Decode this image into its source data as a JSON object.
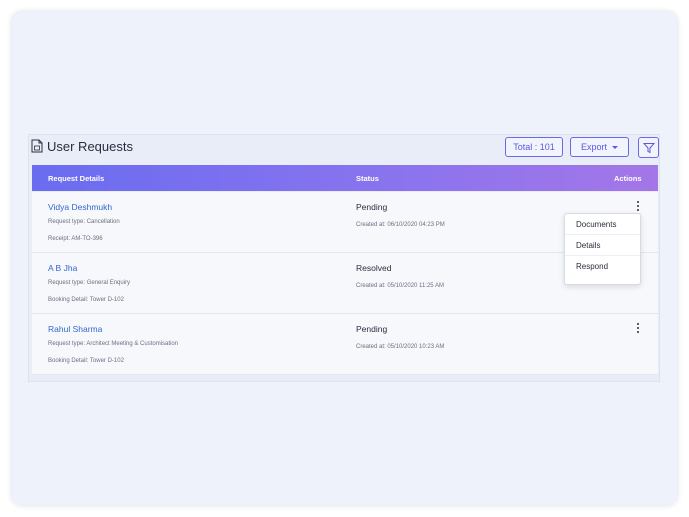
{
  "header": {
    "title": "User Requests",
    "total_label": "Total : 101",
    "export_label": "Export"
  },
  "table": {
    "columns": {
      "details": "Request Details",
      "status": "Status",
      "actions": "Actions"
    },
    "rows": [
      {
        "name": "Vidya Deshmukh",
        "line1": "Request type: Cancellation",
        "line2": "Receipt: AM-TO-396",
        "status": "Pending",
        "created": "Created at: 06/10/2020 04:23 PM"
      },
      {
        "name": "A B Jha",
        "line1": "Request type: General Enquiry",
        "line2": "Booking Detail: Tower D-102",
        "status": "Resolved",
        "created": "Created at: 05/10/2020 11:25 AM"
      },
      {
        "name": "Rahul Sharma",
        "line1": "Request type: Architect Meeting & Customisation",
        "line2": "Booking Detail: Tower D-102",
        "status": "Pending",
        "created": "Created at: 05/10/2020 10:23 AM"
      }
    ]
  },
  "actions_menu": {
    "items": [
      "Documents",
      "Details",
      "Respond"
    ]
  },
  "colors": {
    "accent": "#6a6ae8",
    "header_gradient_start": "#6a6cf0",
    "header_gradient_end": "#a476e8",
    "link": "#3366cc"
  },
  "icons": {
    "title": "document-icon",
    "filter": "filter-icon",
    "row_action": "kebab-menu-icon"
  }
}
